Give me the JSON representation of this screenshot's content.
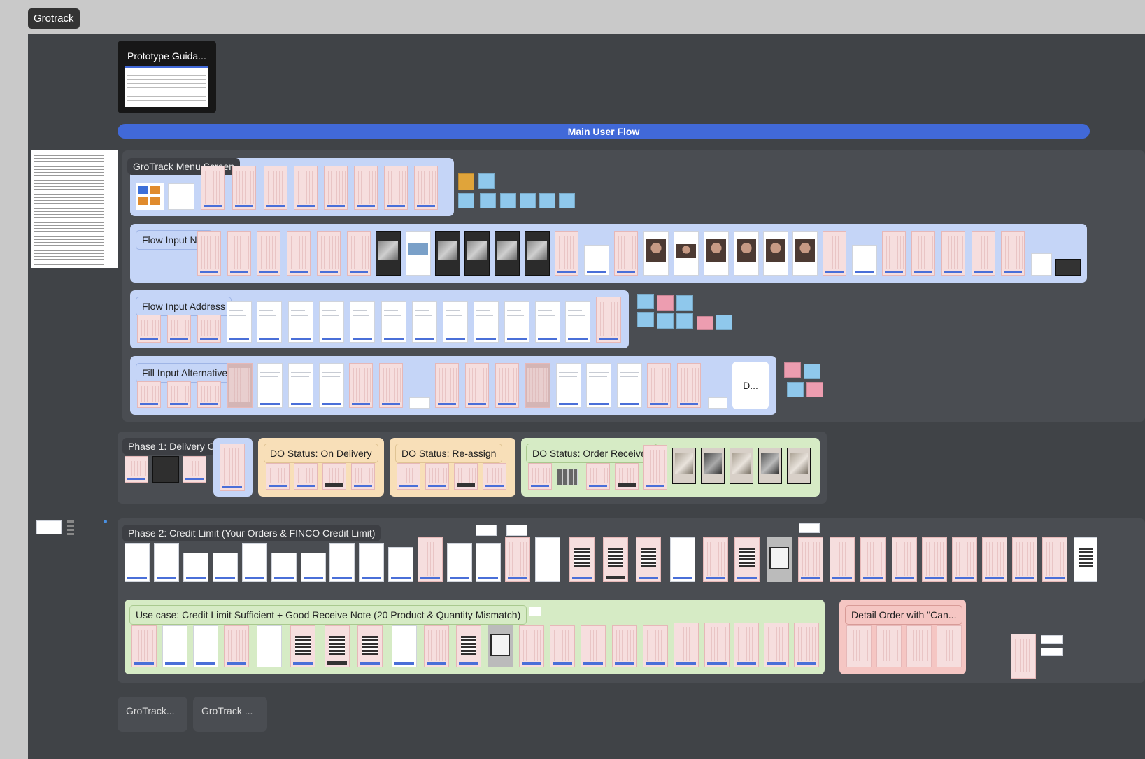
{
  "canvas": {
    "file_name": "Grotrack",
    "prototype_card_title": "Prototype Guida...",
    "banner_title": "Main User Flow",
    "main_flow_sections": [
      {
        "title": "GroTrack Menu Screen"
      },
      {
        "title": "Flow Input NIK"
      },
      {
        "title": "Flow Input Address"
      },
      {
        "title": "Fill Input Alternative"
      }
    ],
    "fill_alt_card_label": "D...",
    "phase1": {
      "title": "Phase 1: Delivery Order",
      "statuses": [
        "DO Status: On Delivery",
        "DO Status: Re-assign",
        "DO Status: Order Received"
      ]
    },
    "phase2": {
      "title": "Phase 2: Credit Limit (Your Orders & FINCO Credit Limit)",
      "use_case_title": "Use case: Credit Limit Sufficient + Good Receive Note (20 Product & Quantity Mismatch)",
      "detail_title": "Detail Order with \"Can..."
    },
    "bottom_frames": [
      "GroTrack...",
      "GroTrack ..."
    ]
  },
  "colors": {
    "canvas_bg": "#404347",
    "banner": "#4169d8",
    "section_blue": "#c5d5f7",
    "status_orange": "#f8dfb8",
    "status_green": "#d6ebc5",
    "detail_pink": "#f5c6c3"
  }
}
